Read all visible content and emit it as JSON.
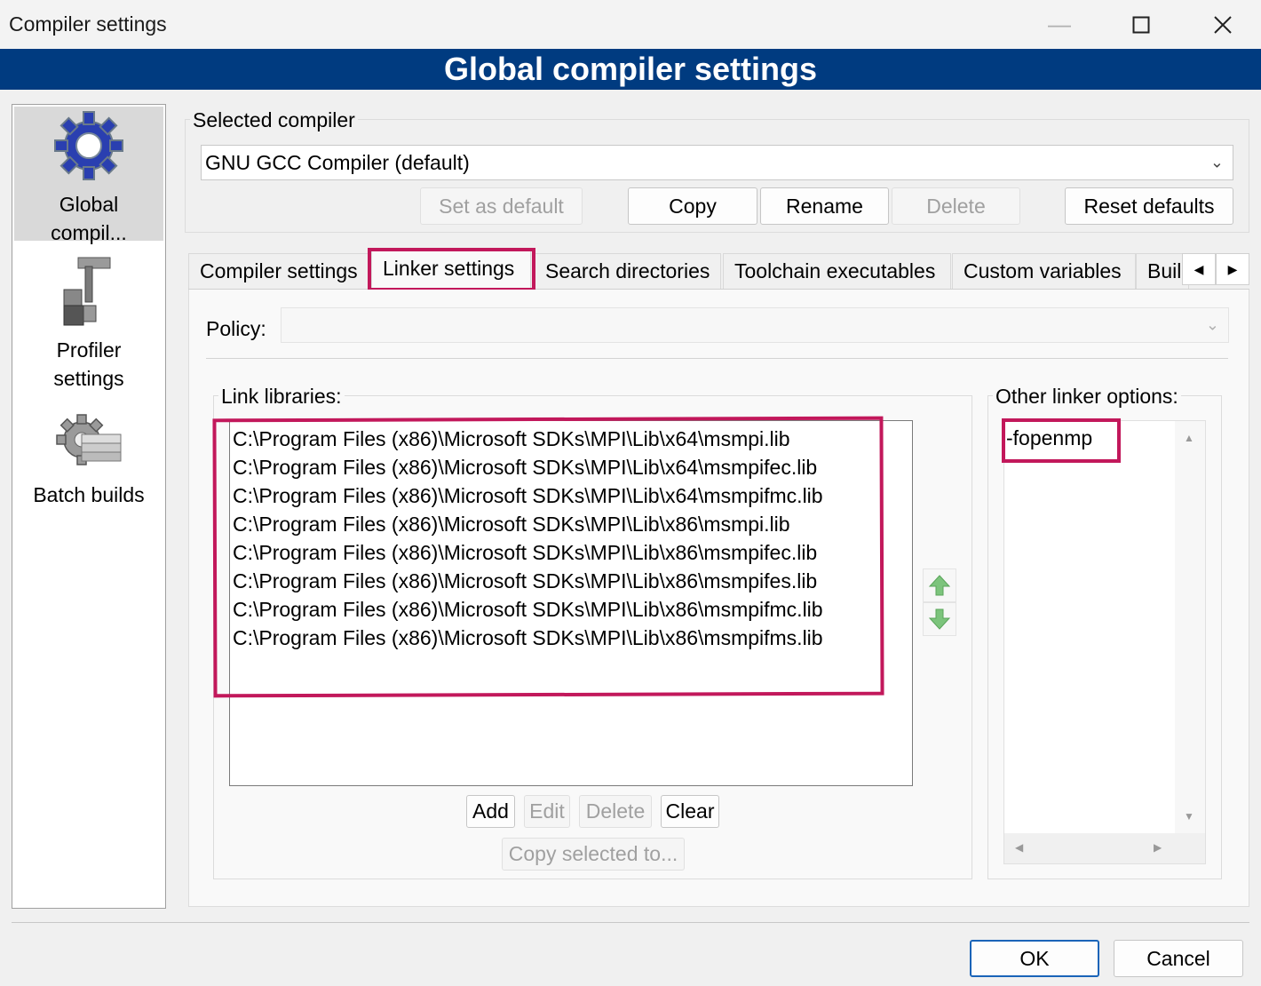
{
  "window": {
    "title": "Compiler settings",
    "minimize_icon": "minimize-icon",
    "maximize_icon": "maximize-icon",
    "close_icon": "close-icon"
  },
  "banner": {
    "title": "Global compiler settings"
  },
  "sidebar": {
    "items": [
      {
        "label_line1": "Global",
        "label_line2": "compil...",
        "icon": "gear-icon",
        "selected": true
      },
      {
        "label_line1": "Profiler",
        "label_line2": "settings",
        "icon": "caliper-icon",
        "selected": false
      },
      {
        "label_line1": "Batch builds",
        "label_line2": "",
        "icon": "gear-stack-icon",
        "selected": false
      }
    ]
  },
  "compiler": {
    "group_label": "Selected compiler",
    "selected": "GNU GCC Compiler (default)",
    "buttons": {
      "set_default": "Set as default",
      "copy": "Copy",
      "rename": "Rename",
      "delete": "Delete",
      "reset_defaults": "Reset defaults"
    }
  },
  "tabs": [
    {
      "label": "Compiler settings",
      "active": false
    },
    {
      "label": "Linker settings",
      "active": true
    },
    {
      "label": "Search directories",
      "active": false
    },
    {
      "label": "Toolchain executables",
      "active": false
    },
    {
      "label": "Custom variables",
      "active": false
    },
    {
      "label": "Buil",
      "active": false
    }
  ],
  "linker": {
    "policy_label": "Policy:",
    "policy_value": "",
    "link_libraries_label": "Link libraries:",
    "link_libraries": [
      "C:\\Program Files (x86)\\Microsoft SDKs\\MPI\\Lib\\x64\\msmpi.lib",
      "C:\\Program Files (x86)\\Microsoft SDKs\\MPI\\Lib\\x64\\msmpifec.lib",
      "C:\\Program Files (x86)\\Microsoft SDKs\\MPI\\Lib\\x64\\msmpifmc.lib",
      "C:\\Program Files (x86)\\Microsoft SDKs\\MPI\\Lib\\x86\\msmpi.lib",
      "C:\\Program Files (x86)\\Microsoft SDKs\\MPI\\Lib\\x86\\msmpifec.lib",
      "C:\\Program Files (x86)\\Microsoft SDKs\\MPI\\Lib\\x86\\msmpifes.lib",
      "C:\\Program Files (x86)\\Microsoft SDKs\\MPI\\Lib\\x86\\msmpifmc.lib",
      "C:\\Program Files (x86)\\Microsoft SDKs\\MPI\\Lib\\x86\\msmpifms.lib"
    ],
    "buttons": {
      "add": "Add",
      "edit": "Edit",
      "delete": "Delete",
      "clear": "Clear",
      "copy_selected": "Copy selected to..."
    },
    "other_options_label": "Other linker options:",
    "other_options": "-fopenmp"
  },
  "footer": {
    "ok": "OK",
    "cancel": "Cancel"
  },
  "colors": {
    "banner": "#003b80",
    "highlight": "#c2185b",
    "arrow_green": "#7cc47c"
  }
}
